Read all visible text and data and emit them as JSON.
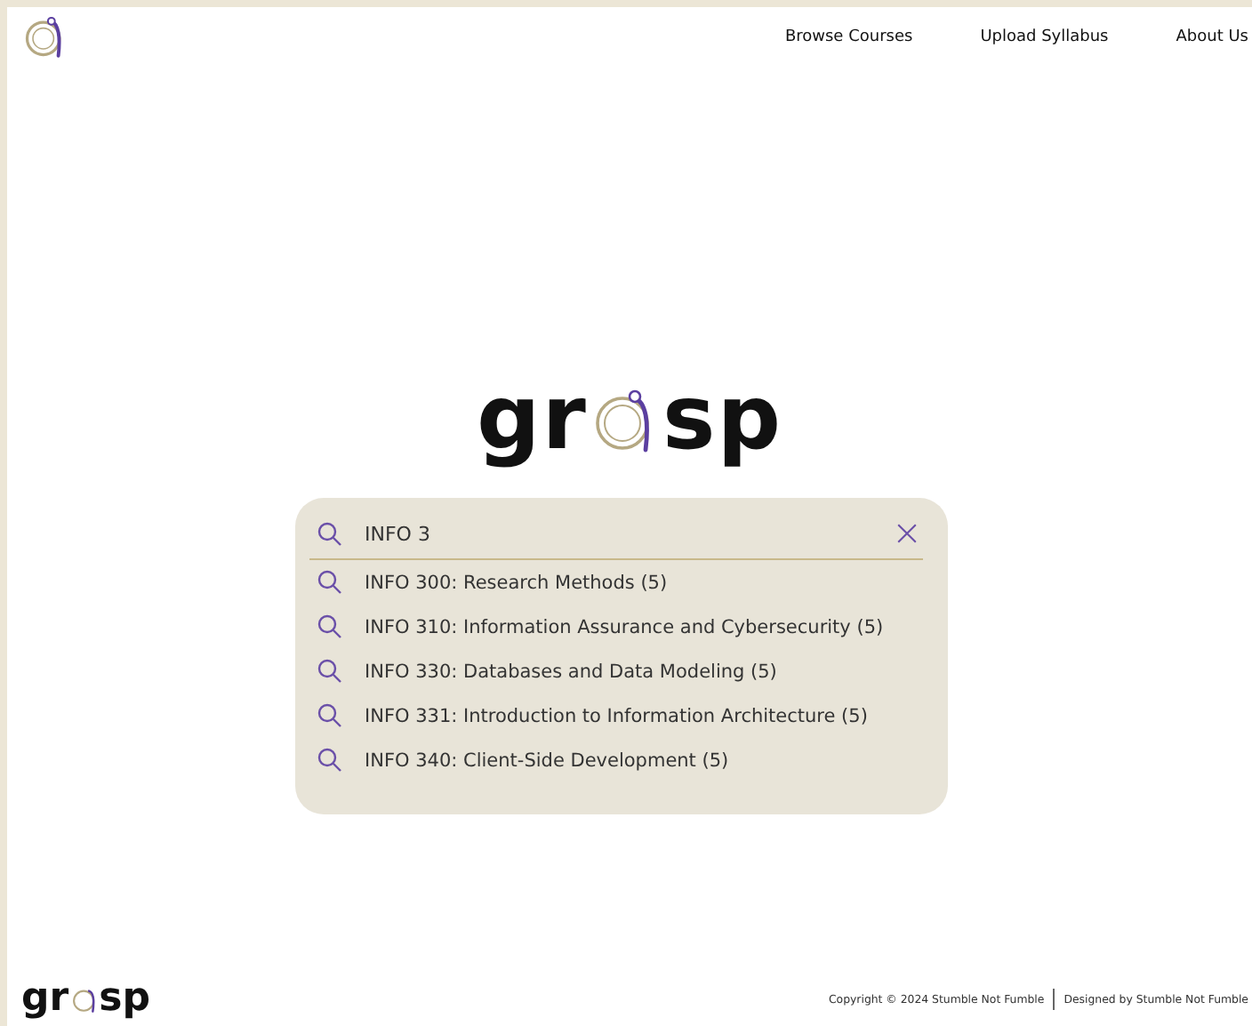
{
  "nav": [
    "Browse Courses",
    "Upload Syllabus",
    "About Us"
  ],
  "logo": {
    "left": "gr",
    "right": "sp"
  },
  "search": {
    "value": "INFO 3"
  },
  "suggestions": [
    "INFO 300: Research Methods (5)",
    "INFO 310: Information Assurance and Cybersecurity (5)",
    "INFO 330: Databases and Data Modeling (5)",
    "INFO 331: Introduction to Information Architecture (5)",
    "INFO 340: Client-Side Development (5)"
  ],
  "footer": {
    "logo": {
      "left": "gr",
      "right": "sp"
    },
    "copyright": "Copyright © 2024 Stumble Not Fumble",
    "credit": "Designed by Stumble Not Fumble"
  }
}
